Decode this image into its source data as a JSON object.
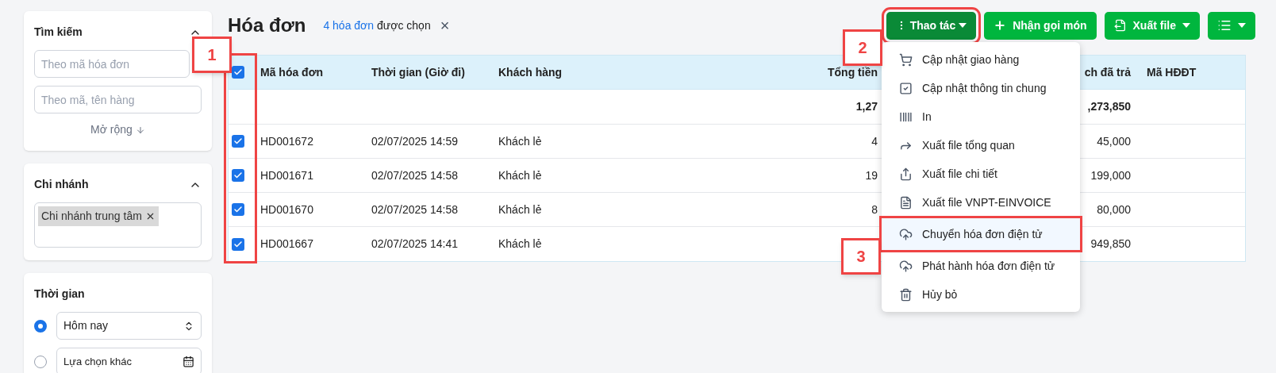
{
  "filters": [
    {
      "kind": "search",
      "title": "Tìm kiếm",
      "expanded": true,
      "fields": [
        {
          "placeholder": "Theo mã hóa đơn"
        },
        {
          "placeholder": "Theo mã, tên hàng"
        }
      ],
      "more_link": "Mở rộng"
    },
    {
      "kind": "tags",
      "title": "Chi nhánh",
      "expanded": true,
      "tags": [
        "Chi nhánh trung tâm"
      ]
    },
    {
      "kind": "time",
      "title": "Thời gian",
      "options": [
        {
          "selected": true,
          "value": "Hôm nay"
        },
        {
          "selected": false,
          "value": "Lựa chọn khác"
        }
      ]
    }
  ],
  "header": {
    "title": "Hóa đơn",
    "selection_link": "4 hóa đơn",
    "selection_text": "được chọn",
    "clear": "×"
  },
  "toolbar": [
    {
      "kind": "menu",
      "label": "Thao tác",
      "open": true
    },
    {
      "kind": "add",
      "label": "Nhận gọi món"
    },
    {
      "kind": "export",
      "label": "Xuất file"
    },
    {
      "kind": "view"
    }
  ],
  "table": {
    "all_checked": true,
    "columns": [
      "Mã hóa đơn",
      "Thời gian (Giờ đi)",
      "Khách hàng",
      "Tổng tiền",
      "ch đã trả",
      "Mã HĐĐT"
    ],
    "totals": {
      "total": "1,27",
      "paid": ",273,850"
    },
    "rows": [
      {
        "checked": true,
        "code": "HD001672",
        "time": "02/07/2025 14:59",
        "customer": "Khách lẻ",
        "total": "4",
        "paid": "45,000"
      },
      {
        "checked": true,
        "code": "HD001671",
        "time": "02/07/2025 14:58",
        "customer": "Khách lẻ",
        "total": "19",
        "paid": "199,000"
      },
      {
        "checked": true,
        "code": "HD001670",
        "time": "02/07/2025 14:58",
        "customer": "Khách lẻ",
        "total": "8",
        "paid": "80,000"
      },
      {
        "checked": true,
        "code": "HD001667",
        "time": "02/07/2025 14:41",
        "customer": "Khách lẻ",
        "total": "",
        "paid": "949,850"
      }
    ]
  },
  "action_menu": [
    {
      "label": "Cập nhật giao hàng",
      "highlighted": false
    },
    {
      "label": "Cập nhật thông tin chung",
      "highlighted": false
    },
    {
      "label": "In",
      "highlighted": false
    },
    {
      "label": "Xuất file tổng quan",
      "highlighted": false
    },
    {
      "label": "Xuất file chi tiết",
      "highlighted": false
    },
    {
      "label": "Xuất file VNPT-EINVOICE",
      "highlighted": false
    },
    {
      "label": "Chuyển hóa đơn điện tử",
      "highlighted": true
    },
    {
      "label": "Phát hành hóa đơn điện tử",
      "highlighted": false
    },
    {
      "label": "Hủy bỏ",
      "highlighted": false
    }
  ],
  "callouts": [
    "1",
    "2",
    "3"
  ]
}
